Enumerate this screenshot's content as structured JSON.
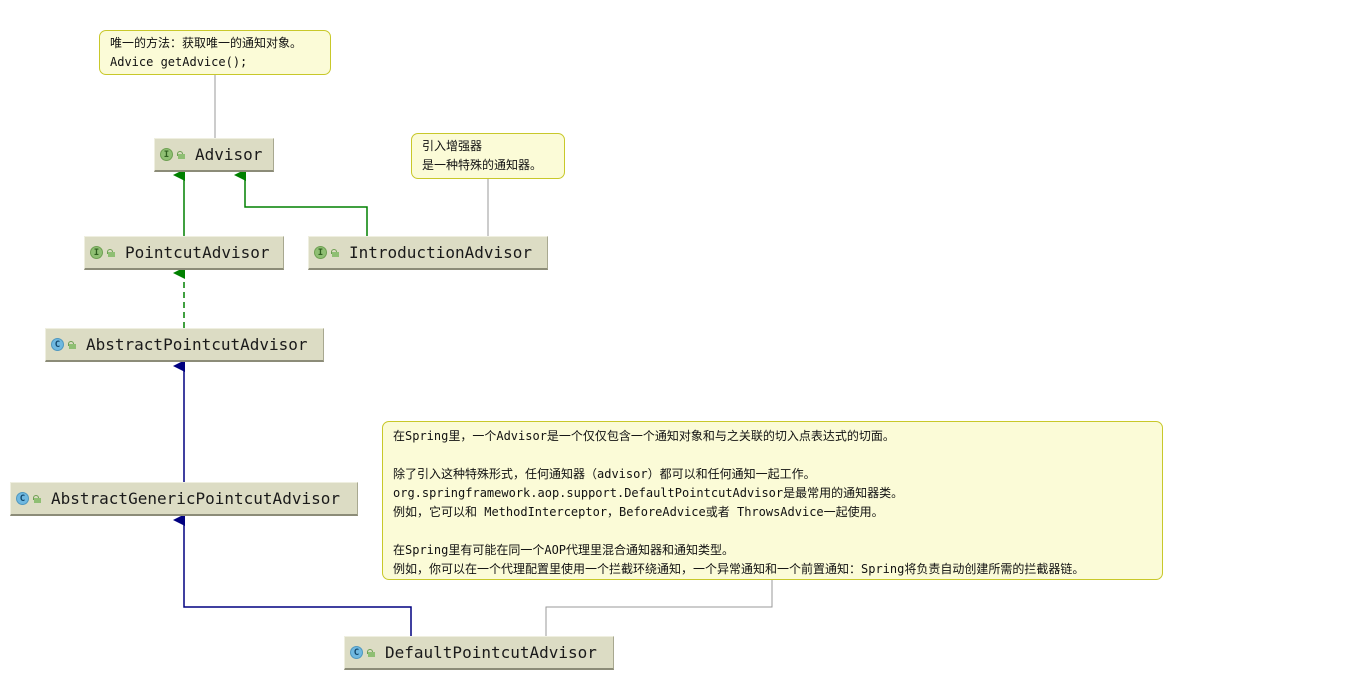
{
  "classes": {
    "advisor": {
      "name": "Advisor",
      "kind": "I"
    },
    "pointcut_advisor": {
      "name": "PointcutAdvisor",
      "kind": "I"
    },
    "introduction_advisor": {
      "name": "IntroductionAdvisor",
      "kind": "I"
    },
    "abstract_pointcut_advisor": {
      "name": "AbstractPointcutAdvisor",
      "kind": "C"
    },
    "abstract_generic_pointcut_advisor": {
      "name": "AbstractGenericPointcutAdvisor",
      "kind": "C"
    },
    "default_pointcut_advisor": {
      "name": "DefaultPointcutAdvisor",
      "kind": "C"
    }
  },
  "notes": {
    "advisor_note": [
      "唯一的方法：获取唯一的通知对象。",
      "Advice getAdvice();"
    ],
    "introduction_note": [
      "引入增强器",
      "是一种特殊的通知器。"
    ],
    "default_note": [
      "在Spring里，一个Advisor是一个仅仅包含一个通知对象和与之关联的切入点表达式的切面。",
      "",
      "除了引入这种特殊形式，任何通知器（advisor）都可以和任何通知一起工作。",
      "org.springframework.aop.support.DefaultPointcutAdvisor是最常用的通知器类。",
      "例如，它可以和 MethodInterceptor，BeforeAdvice或者 ThrowsAdvice一起使用。",
      "",
      "在Spring里有可能在同一个AOP代理里混合通知器和通知类型。",
      "例如，你可以在一个代理配置里使用一个拦截环绕通知，一个异常通知和一个前置通知：Spring将负责自动创建所需的拦截器链。"
    ]
  },
  "colors": {
    "interface_extends": "#008000",
    "implements": "#008000",
    "class_extends": "#000080",
    "note_link": "#999999"
  }
}
